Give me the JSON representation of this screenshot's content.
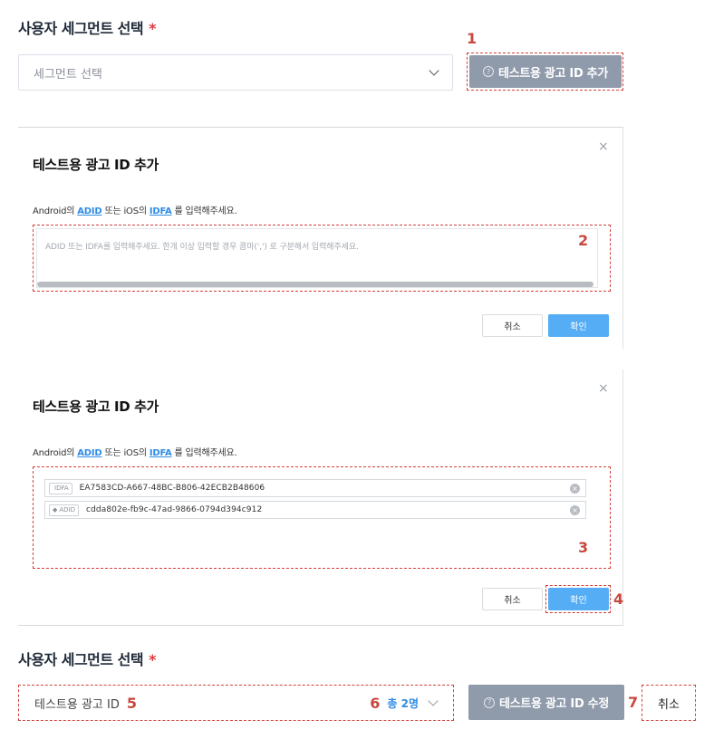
{
  "top": {
    "section_title": "사용자 세그먼트 선택",
    "required_mark": "*",
    "select_placeholder": "세그먼트 선택",
    "add_button_label": "테스트용 광고 ID 추가",
    "help_glyph": "?"
  },
  "modal_empty": {
    "title": "테스트용 광고 ID 추가",
    "close_glyph": "×",
    "desc_prefix": "Android의",
    "desc_adid": "ADID",
    "desc_mid": "또는 iOS의",
    "desc_idfa": "IDFA",
    "desc_suffix": "를 입력해주세요.",
    "textarea_placeholder": "ADID 또는 IDFA를 입력해주세요. 한개 이상 입력할 경우 콤마(',') 로 구분해서 입력해주세요.",
    "cancel_label": "취소",
    "confirm_label": "확인"
  },
  "modal_filled": {
    "title": "테스트용 광고 ID 추가",
    "close_glyph": "×",
    "desc_prefix": "Android의",
    "desc_adid": "ADID",
    "desc_mid": "또는 iOS의",
    "desc_idfa": "IDFA",
    "desc_suffix": "를 입력해주세요.",
    "entries": [
      {
        "badge_icon": "apple-icon",
        "badge_glyph": "",
        "badge": "IDFA",
        "value": "EA7583CD-A667-48BC-B806-42ECB2B48606",
        "remove_glyph": "×"
      },
      {
        "badge_icon": "android-icon",
        "badge_glyph": "◆",
        "badge": "ADID",
        "value": "cdda802e-fb9c-47ad-9866-0794d394c912",
        "remove_glyph": "×"
      }
    ],
    "cancel_label": "취소",
    "confirm_label": "확인"
  },
  "bottom": {
    "section_title": "사용자 세그먼트 선택",
    "required_mark": "*",
    "segment_label": "테스트용 광고 ID",
    "segment_count": "총 2명",
    "edit_button_label": "테스트용 광고 ID 수정",
    "cancel_label": "취소",
    "help_glyph": "?"
  },
  "markers": [
    "1",
    "2",
    "3",
    "4",
    "5",
    "6",
    "7"
  ],
  "colors": {
    "accent_blue": "#54adf5",
    "link_blue": "#2e8ce6",
    "gray_button": "#8f9aab",
    "annotation_red": "#d1403a",
    "required_red": "#e0393e"
  }
}
